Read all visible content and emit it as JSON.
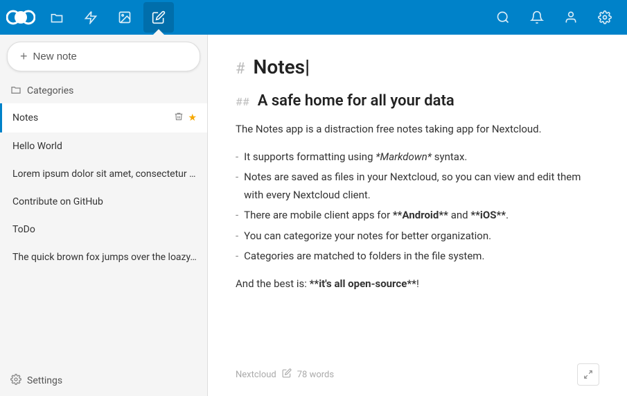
{
  "topbar": {
    "apps": [
      {
        "id": "files",
        "label": "Files",
        "icon": "📁",
        "active": false
      },
      {
        "id": "activity",
        "label": "Activity",
        "icon": "⚡",
        "active": false
      },
      {
        "id": "photos",
        "label": "Photos",
        "icon": "🖼",
        "active": false
      },
      {
        "id": "notes",
        "label": "Notes",
        "icon": "✏️",
        "active": true
      }
    ],
    "right_icons": [
      {
        "id": "search",
        "label": "Search",
        "icon": "🔍"
      },
      {
        "id": "notifications",
        "label": "Notifications",
        "icon": "🔔"
      },
      {
        "id": "contacts",
        "label": "Contacts",
        "icon": "👤"
      },
      {
        "id": "settings",
        "label": "Settings",
        "icon": "⚙️"
      }
    ]
  },
  "sidebar": {
    "new_note_label": "New note",
    "categories_label": "Categories",
    "notes": [
      {
        "id": "notes",
        "label": "Notes",
        "active": true,
        "has_delete": true,
        "has_star": true
      },
      {
        "id": "hello-world",
        "label": "Hello World",
        "active": false,
        "has_delete": false,
        "has_star": false
      },
      {
        "id": "lorem",
        "label": "Lorem ipsum dolor sit amet, consectetur ...",
        "active": false,
        "has_delete": false,
        "has_star": false
      },
      {
        "id": "contribute",
        "label": "Contribute on GitHub",
        "active": false,
        "has_delete": false,
        "has_star": false
      },
      {
        "id": "todo",
        "label": "ToDo",
        "active": false,
        "has_delete": false,
        "has_star": false
      },
      {
        "id": "quick-fox",
        "label": "The quick brown fox jumps over the loazy...",
        "active": false,
        "has_delete": false,
        "has_star": false
      }
    ],
    "settings_label": "Settings"
  },
  "note": {
    "title": "Notes",
    "section_heading": "A safe home for all your data",
    "intro": "The Notes app is a distraction free notes taking app for Nextcloud.",
    "bullets": [
      {
        "text": "It supports formatting using ",
        "em": "*Markdown*",
        "em_suffix": " syntax."
      },
      {
        "text": "Notes are saved as files in your Nextcloud, so you can view and edit them with every Nextcloud client."
      },
      {
        "text": "There are mobile client apps for ",
        "bold": "**Android**",
        "mid": " and ",
        "bold2": "**iOS**",
        "suffix": "."
      },
      {
        "text": "You can categorize your notes for better organization."
      },
      {
        "text": "Categories are matched to folders in the file system."
      }
    ],
    "closing": "And the best is: ",
    "closing_bold": "**it's all open-source**",
    "closing_suffix": "!",
    "footer": {
      "author": "Nextcloud",
      "word_count": "78 words"
    }
  }
}
